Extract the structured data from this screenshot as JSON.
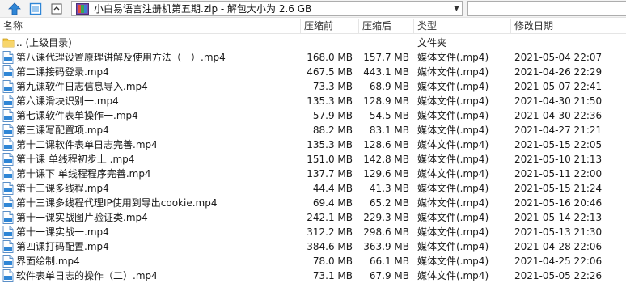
{
  "toolbar": {
    "up_icon": "up-arrow-icon",
    "view_icon": "view-toggle-icon",
    "path": "小白易语言注册机第五期.zip - 解包大小为 2.6 GB",
    "search_value": ""
  },
  "columns": {
    "name": "名称",
    "packed": "压缩前",
    "size": "压缩后",
    "type": "类型",
    "modified": "修改日期"
  },
  "parent": {
    "name": ".. (上级目录)",
    "type": "文件夹"
  },
  "files": [
    {
      "name": "第八课代理设置原理讲解及使用方法（一）.mp4",
      "packed": "168.0 MB",
      "size": "157.7 MB",
      "type": "媒体文件(.mp4)",
      "modified": "2021-05-04 22:07"
    },
    {
      "name": "第二课接码登录.mp4",
      "packed": "467.5 MB",
      "size": "443.1 MB",
      "type": "媒体文件(.mp4)",
      "modified": "2021-04-26 22:29"
    },
    {
      "name": "第九课软件日志信息导入.mp4",
      "packed": "73.3 MB",
      "size": "68.9 MB",
      "type": "媒体文件(.mp4)",
      "modified": "2021-05-07 22:41"
    },
    {
      "name": "第六课滑块识别一.mp4",
      "packed": "135.3 MB",
      "size": "128.9 MB",
      "type": "媒体文件(.mp4)",
      "modified": "2021-04-30 21:50"
    },
    {
      "name": "第七课软件表单操作一.mp4",
      "packed": "57.9 MB",
      "size": "54.5 MB",
      "type": "媒体文件(.mp4)",
      "modified": "2021-04-30 22:36"
    },
    {
      "name": "第三课写配置项.mp4",
      "packed": "88.2 MB",
      "size": "83.1 MB",
      "type": "媒体文件(.mp4)",
      "modified": "2021-04-27 21:21"
    },
    {
      "name": "第十二课软件表单日志完善.mp4",
      "packed": "135.3 MB",
      "size": "128.6 MB",
      "type": "媒体文件(.mp4)",
      "modified": "2021-05-15 22:05"
    },
    {
      "name": "第十课 单线程初步上 .mp4",
      "packed": "151.0 MB",
      "size": "142.8 MB",
      "type": "媒体文件(.mp4)",
      "modified": "2021-05-10 21:13"
    },
    {
      "name": "第十课下 单线程程序完善.mp4",
      "packed": "137.7 MB",
      "size": "129.6 MB",
      "type": "媒体文件(.mp4)",
      "modified": "2021-05-11 22:00"
    },
    {
      "name": "第十三课多线程.mp4",
      "packed": "44.4 MB",
      "size": "41.3 MB",
      "type": "媒体文件(.mp4)",
      "modified": "2021-05-15 21:24"
    },
    {
      "name": "第十三课多线程代理IP使用到导出cookie.mp4",
      "packed": "69.4 MB",
      "size": "65.2 MB",
      "type": "媒体文件(.mp4)",
      "modified": "2021-05-16 20:46"
    },
    {
      "name": "第十一课实战图片验证类.mp4",
      "packed": "242.1 MB",
      "size": "229.3 MB",
      "type": "媒体文件(.mp4)",
      "modified": "2021-05-14 22:13"
    },
    {
      "name": "第十一课实战一.mp4",
      "packed": "312.2 MB",
      "size": "298.6 MB",
      "type": "媒体文件(.mp4)",
      "modified": "2021-05-13 21:30"
    },
    {
      "name": "第四课打码配置.mp4",
      "packed": "384.6 MB",
      "size": "363.9 MB",
      "type": "媒体文件(.mp4)",
      "modified": "2021-04-28 22:06"
    },
    {
      "name": "界面绘制.mp4",
      "packed": "78.0 MB",
      "size": "66.1 MB",
      "type": "媒体文件(.mp4)",
      "modified": "2021-04-25 22:06"
    },
    {
      "name": "软件表单日志的操作（二）.mp4",
      "packed": "73.1 MB",
      "size": "67.9 MB",
      "type": "媒体文件(.mp4)",
      "modified": "2021-05-05 22:26"
    }
  ],
  "file_icon": "mp4-file-icon",
  "folder_icon": "folder-up-icon",
  "colors": {
    "accent": "#1e73c8",
    "folder": "#f2c744",
    "border": "#e5e5e5"
  }
}
